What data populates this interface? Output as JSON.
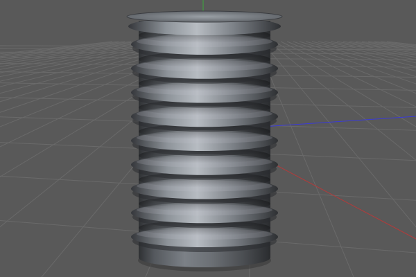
{
  "viewport": {
    "background_color": "#595959",
    "grid_color": "#6a6a6a",
    "grid_line_color_major": "#707070",
    "axis_colors": {
      "x": "#b43a3a",
      "y": "#3aaa3a",
      "z": "#3a3ad8"
    },
    "grid_visible": true
  },
  "object": {
    "type": "ribbed-cylinder",
    "material_color": "#6c7075",
    "highlight_color": "#b7bcc2",
    "shadow_color": "#2a2c2f",
    "rib_count": 9
  }
}
